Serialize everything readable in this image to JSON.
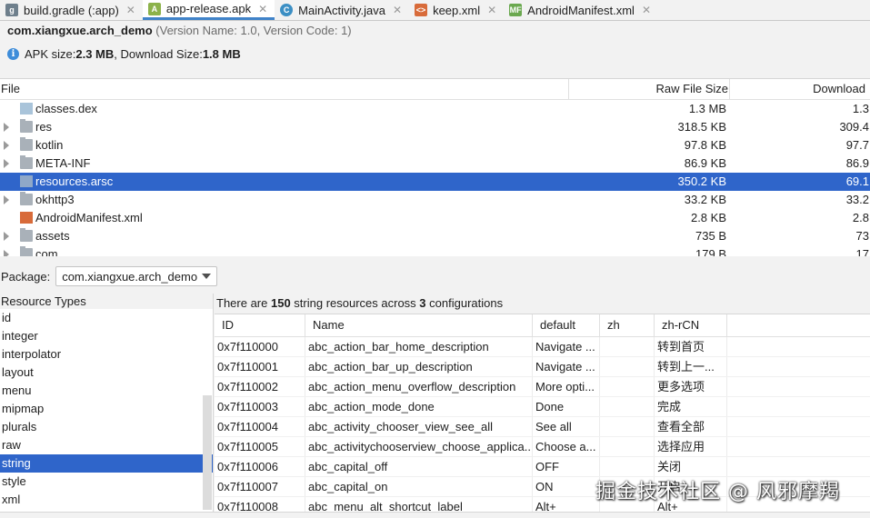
{
  "tabs": [
    {
      "label": "build.gradle (:app)",
      "icon": "gradle-icon",
      "active": false
    },
    {
      "label": "app-release.apk",
      "icon": "apk-icon",
      "active": true
    },
    {
      "label": "MainActivity.java",
      "icon": "java-class-icon",
      "active": false
    },
    {
      "label": "keep.xml",
      "icon": "xml-file-icon",
      "active": false
    },
    {
      "label": "AndroidManifest.xml",
      "icon": "manifest-icon",
      "active": false
    }
  ],
  "header": {
    "package": "com.xiangxue.arch_demo",
    "version": "(Version Name: 1.0, Version Code: 1)",
    "size_prefix": "APK size: ",
    "apk_size": "2.3 MB",
    "size_mid": ", Download Size: ",
    "download_size": "1.8 MB"
  },
  "files": {
    "columns": {
      "file": "File",
      "raw": "Raw File Size",
      "download": "Download"
    },
    "rows": [
      {
        "name": "classes.dex",
        "raw": "1.3 MB",
        "download": "1.3",
        "expandable": false,
        "icon": "dex-file-icon"
      },
      {
        "name": "res",
        "raw": "318.5 KB",
        "download": "309.4",
        "expandable": true,
        "icon": "res-folder-icon"
      },
      {
        "name": "kotlin",
        "raw": "97.8 KB",
        "download": "97.7",
        "expandable": true,
        "icon": "folder-icon"
      },
      {
        "name": "META-INF",
        "raw": "86.9 KB",
        "download": "86.9",
        "expandable": true,
        "icon": "folder-icon"
      },
      {
        "name": "resources.arsc",
        "raw": "350.2 KB",
        "download": "69.1",
        "expandable": false,
        "icon": "arsc-file-icon",
        "selected": true
      },
      {
        "name": "okhttp3",
        "raw": "33.2 KB",
        "download": "33.2",
        "expandable": true,
        "icon": "folder-icon"
      },
      {
        "name": "AndroidManifest.xml",
        "raw": "2.8 KB",
        "download": "2.8",
        "expandable": false,
        "icon": "xml-file-icon"
      },
      {
        "name": "assets",
        "raw": "735 B",
        "download": "73",
        "expandable": true,
        "icon": "folder-icon"
      },
      {
        "name": "com",
        "raw": "179 B",
        "download": "17",
        "expandable": true,
        "icon": "folder-icon"
      }
    ]
  },
  "package_bar": {
    "label": "Package:",
    "selected": "com.xiangxue.arch_demo"
  },
  "resource_types": {
    "title": "Resource Types",
    "items": [
      "id",
      "integer",
      "interpolator",
      "layout",
      "menu",
      "mipmap",
      "plurals",
      "raw",
      "string",
      "style",
      "xml"
    ],
    "selected": "string"
  },
  "resources": {
    "summary_pre": "There are ",
    "count": "150",
    "summary_mid": " string resources across ",
    "configs": "3",
    "summary_post": " configurations",
    "columns": [
      "ID",
      "Name",
      "default",
      "zh",
      "zh-rCN"
    ],
    "rows": [
      [
        "0x7f110000",
        "abc_action_bar_home_description",
        "Navigate ...",
        "",
        "转到首页"
      ],
      [
        "0x7f110001",
        "abc_action_bar_up_description",
        "Navigate ...",
        "",
        "转到上一..."
      ],
      [
        "0x7f110002",
        "abc_action_menu_overflow_description",
        "More opti...",
        "",
        "更多选项"
      ],
      [
        "0x7f110003",
        "abc_action_mode_done",
        "Done",
        "",
        "完成"
      ],
      [
        "0x7f110004",
        "abc_activity_chooser_view_see_all",
        "See all",
        "",
        "查看全部"
      ],
      [
        "0x7f110005",
        "abc_activitychooserview_choose_applica...",
        "Choose a...",
        "",
        "选择应用"
      ],
      [
        "0x7f110006",
        "abc_capital_off",
        "OFF",
        "",
        "关闭"
      ],
      [
        "0x7f110007",
        "abc_capital_on",
        "ON",
        "",
        "开启"
      ],
      [
        "0x7f110008",
        "abc_menu_alt_shortcut_label",
        "Alt+",
        "",
        "Alt+"
      ]
    ]
  },
  "watermark": "掘金技术社区 @ 风邪摩羯",
  "colors": {
    "selection": "#2f65ca",
    "tab_underline": "#4083c9",
    "info": "#3d8cd9"
  }
}
